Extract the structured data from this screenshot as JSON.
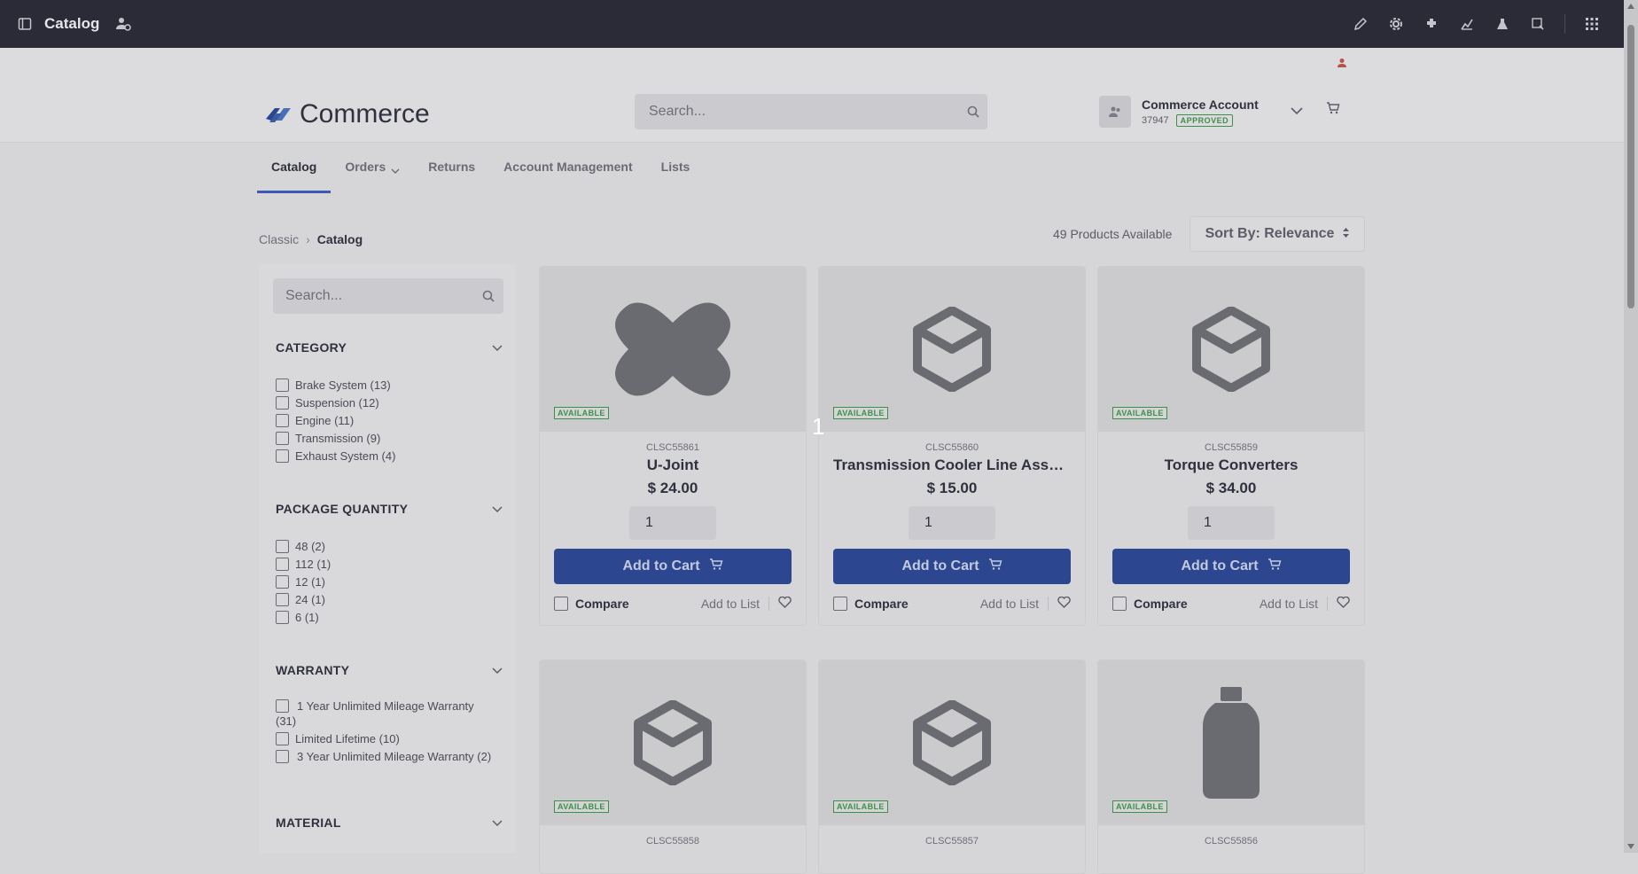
{
  "topbar": {
    "title": "Catalog"
  },
  "header": {
    "brand": "Commerce",
    "search_placeholder": "Search...",
    "account_name": "Commerce Account",
    "account_id": "37947",
    "account_status": "APPROVED"
  },
  "nav": {
    "tabs": [
      {
        "label": "Catalog"
      },
      {
        "label": "Orders"
      },
      {
        "label": "Returns"
      },
      {
        "label": "Account Management"
      },
      {
        "label": "Lists"
      }
    ]
  },
  "breadcrumb": {
    "parent": "Classic",
    "current": "Catalog"
  },
  "results": {
    "count_text": "49 Products Available",
    "sort_label": "Sort By: Relevance"
  },
  "filters": {
    "search_placeholder": "Search...",
    "groups": [
      {
        "title": "CATEGORY",
        "options": [
          "Brake System (13)",
          "Suspension (12)",
          "Engine (11)",
          "Transmission (9)",
          "Exhaust System (4)"
        ]
      },
      {
        "title": "PACKAGE QUANTITY",
        "options": [
          "48 (2)",
          "112 (1)",
          "12 (1)",
          "24 (1)",
          "6 (1)"
        ]
      },
      {
        "title": "WARRANTY",
        "options": [
          "1 Year Unlimited Mileage Warranty (31)",
          "Limited Lifetime (10)",
          "3 Year Unlimited Mileage Warranty (2)"
        ]
      },
      {
        "title": "MATERIAL",
        "options": []
      }
    ]
  },
  "product_labels": {
    "available": "AVAILABLE",
    "add_to_cart": "Add to Cart",
    "compare": "Compare",
    "add_to_list": "Add to List"
  },
  "products": [
    {
      "sku": "CLSC55861",
      "name": "U-Joint",
      "price": "$ 24.00",
      "qty": "1"
    },
    {
      "sku": "CLSC55860",
      "name": "Transmission Cooler Line Assem...",
      "price": "$ 15.00",
      "qty": "1"
    },
    {
      "sku": "CLSC55859",
      "name": "Torque Converters",
      "price": "$ 34.00",
      "qty": "1"
    },
    {
      "sku": "CLSC55858"
    },
    {
      "sku": "CLSC55857"
    },
    {
      "sku": "CLSC55856"
    }
  ],
  "overlay": {
    "number": "1"
  },
  "colors": {
    "topbar": "#2a2b37",
    "primary_button": "#2c4690",
    "available_green": "#3e8f4e",
    "nav_active": "#3d5ab4"
  }
}
